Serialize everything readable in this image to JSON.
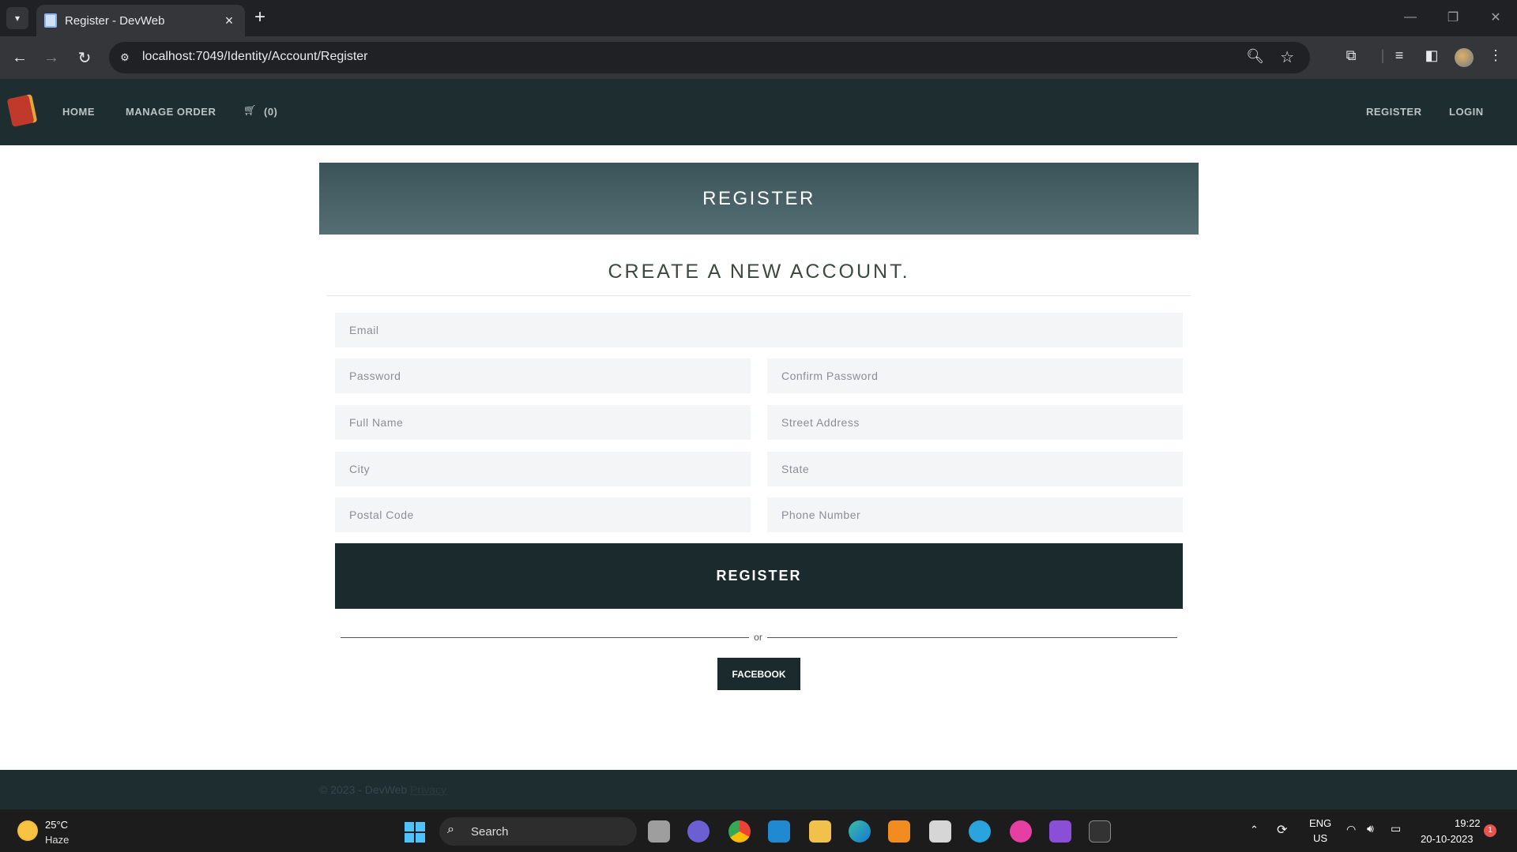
{
  "browser": {
    "tab_title": "Register - DevWeb",
    "url": "localhost:7049/Identity/Account/Register"
  },
  "site_nav": {
    "home": "HOME",
    "manage_order": "MANAGE ORDER",
    "cart_count": "(0)",
    "register": "REGISTER",
    "login": "LOGIN"
  },
  "page": {
    "banner_title": "REGISTER",
    "subtitle": "CREATE A NEW ACCOUNT.",
    "fields": {
      "email": "Email",
      "password": "Password",
      "confirm_password": "Confirm Password",
      "full_name": "Full Name",
      "street_address": "Street Address",
      "city": "City",
      "state": "State",
      "postal_code": "Postal Code",
      "phone_number": "Phone Number"
    },
    "submit_label": "REGISTER",
    "or_text": "or",
    "facebook_label": "FACEBOOK"
  },
  "footer": {
    "copyright": "© 2023 - DevWeb",
    "privacy": "Privacy"
  },
  "taskbar": {
    "temperature": "25°C",
    "weather": "Haze",
    "search_label": "Search",
    "lang_line1": "ENG",
    "lang_line2": "US",
    "time": "19:22",
    "date": "20-10-2023",
    "notification_count": "1"
  },
  "colors": {
    "nav_bg": "#1e2e30",
    "button_bg": "#1b2a2d",
    "banner_gradient_top": "#3a5459",
    "banner_gradient_bottom": "#546e73"
  }
}
